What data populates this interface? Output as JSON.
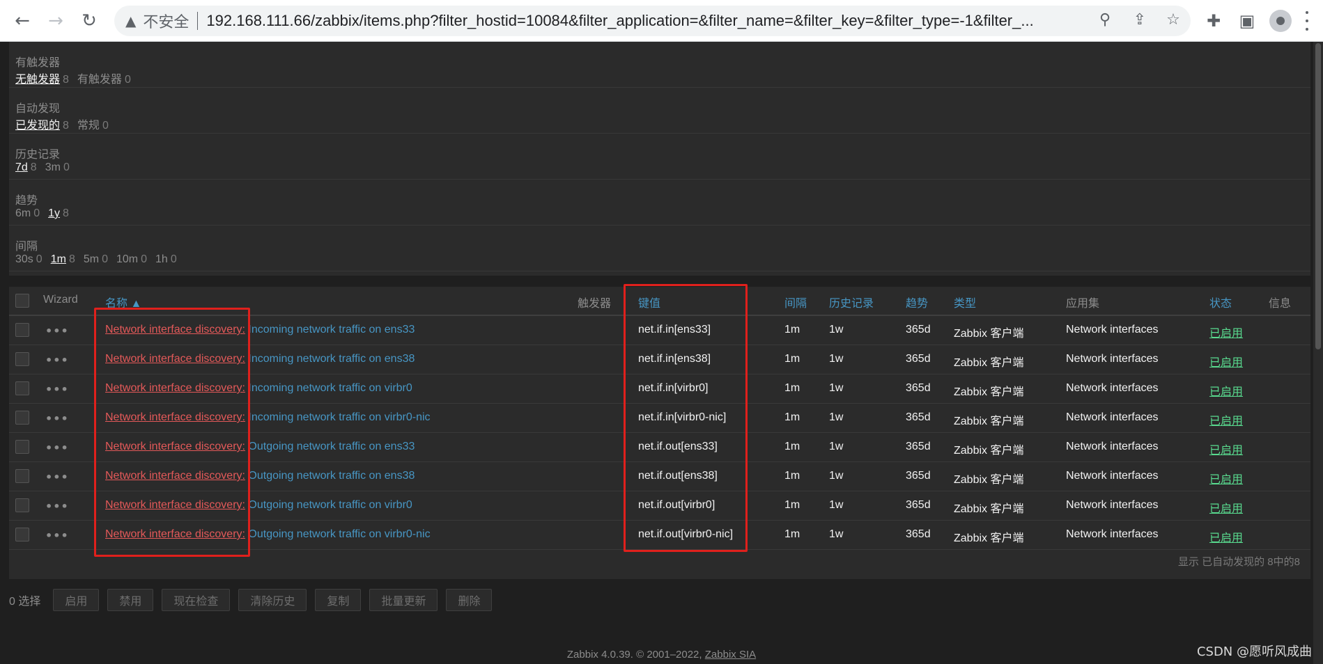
{
  "browser": {
    "back_icon": "←",
    "forward_icon": "→",
    "reload_icon": "↻",
    "warning_icon": "▲",
    "insecure_label": "不安全",
    "url": "192.168.111.66/zabbix/items.php?filter_hostid=10084&filter_application=&filter_name=&filter_key=&filter_type=-1&filter_...",
    "zoom_icon": "⚲",
    "share_icon": "⇪",
    "star_icon": "☆",
    "extensions_icon": "✚",
    "sidepanel_icon": "▣"
  },
  "filters": [
    {
      "title": "有触发器",
      "options": [
        {
          "label": "无触发器",
          "count": "8",
          "selected": true
        },
        {
          "label": "有触发器",
          "count": "0",
          "selected": false
        }
      ]
    },
    {
      "title": "自动发现",
      "options": [
        {
          "label": "已发现的",
          "count": "8",
          "selected": true
        },
        {
          "label": "常规",
          "count": "0",
          "selected": false
        }
      ]
    },
    {
      "title": "历史记录",
      "options": [
        {
          "label": "7d",
          "count": "8",
          "selected": true
        },
        {
          "label": "3m",
          "count": "0",
          "selected": false
        }
      ]
    },
    {
      "title": "趋势",
      "options": [
        {
          "label": "6m",
          "count": "0",
          "selected": false
        },
        {
          "label": "1y",
          "count": "8",
          "selected": true
        }
      ]
    },
    {
      "title": "间隔",
      "options": [
        {
          "label": "30s",
          "count": "0",
          "selected": false
        },
        {
          "label": "1m",
          "count": "8",
          "selected": true
        },
        {
          "label": "5m",
          "count": "0",
          "selected": false
        },
        {
          "label": "10m",
          "count": "0",
          "selected": false
        },
        {
          "label": "1h",
          "count": "0",
          "selected": false
        }
      ]
    }
  ],
  "table": {
    "headers": {
      "wizard": "Wizard",
      "name": "名称 ▲",
      "triggers": "触发器",
      "key": "键值",
      "interval": "间隔",
      "history": "历史记录",
      "trends": "趋势",
      "type": "类型",
      "applications": "应用集",
      "status": "状态",
      "info": "信息"
    },
    "rows": [
      {
        "prefix": "Network interface discovery:",
        "name": " Incoming network traffic on ens33",
        "key": "net.if.in[ens33]",
        "interval": "1m",
        "history": "1w",
        "trends": "365d",
        "type": "Zabbix 客户端",
        "app": "Network interfaces",
        "status": "已启用"
      },
      {
        "prefix": "Network interface discovery:",
        "name": " Incoming network traffic on ens38",
        "key": "net.if.in[ens38]",
        "interval": "1m",
        "history": "1w",
        "trends": "365d",
        "type": "Zabbix 客户端",
        "app": "Network interfaces",
        "status": "已启用"
      },
      {
        "prefix": "Network interface discovery:",
        "name": " Incoming network traffic on virbr0",
        "key": "net.if.in[virbr0]",
        "interval": "1m",
        "history": "1w",
        "trends": "365d",
        "type": "Zabbix 客户端",
        "app": "Network interfaces",
        "status": "已启用"
      },
      {
        "prefix": "Network interface discovery:",
        "name": " Incoming network traffic on virbr0-nic",
        "key": "net.if.in[virbr0-nic]",
        "interval": "1m",
        "history": "1w",
        "trends": "365d",
        "type": "Zabbix 客户端",
        "app": "Network interfaces",
        "status": "已启用"
      },
      {
        "prefix": "Network interface discovery:",
        "name": " Outgoing network traffic on ens33",
        "key": "net.if.out[ens33]",
        "interval": "1m",
        "history": "1w",
        "trends": "365d",
        "type": "Zabbix 客户端",
        "app": "Network interfaces",
        "status": "已启用"
      },
      {
        "prefix": "Network interface discovery:",
        "name": " Outgoing network traffic on ens38",
        "key": "net.if.out[ens38]",
        "interval": "1m",
        "history": "1w",
        "trends": "365d",
        "type": "Zabbix 客户端",
        "app": "Network interfaces",
        "status": "已启用"
      },
      {
        "prefix": "Network interface discovery:",
        "name": " Outgoing network traffic on virbr0",
        "key": "net.if.out[virbr0]",
        "interval": "1m",
        "history": "1w",
        "trends": "365d",
        "type": "Zabbix 客户端",
        "app": "Network interfaces",
        "status": "已启用"
      },
      {
        "prefix": "Network interface discovery:",
        "name": " Outgoing network traffic on virbr0-nic",
        "key": "net.if.out[virbr0-nic]",
        "interval": "1m",
        "history": "1w",
        "trends": "365d",
        "type": "Zabbix 客户端",
        "app": "Network interfaces",
        "status": "已启用"
      }
    ],
    "row_menu": "•••",
    "footer": "显示 已自动发现的 8中的8"
  },
  "actions": {
    "selected": "0 选择",
    "buttons": [
      "启用",
      "禁用",
      "现在检查",
      "清除历史",
      "复制",
      "批量更新",
      "删除"
    ]
  },
  "footer": {
    "text": "Zabbix 4.0.39. © 2001–2022, ",
    "link": "Zabbix SIA"
  },
  "watermark": "CSDN @愿听风成曲",
  "colors": {
    "background": "#1f1f1f",
    "panel": "#2b2b2b",
    "link": "#4796c4",
    "red_link": "#e45959",
    "status_enabled": "#59db8f",
    "highlight_box": "#e0201c"
  }
}
